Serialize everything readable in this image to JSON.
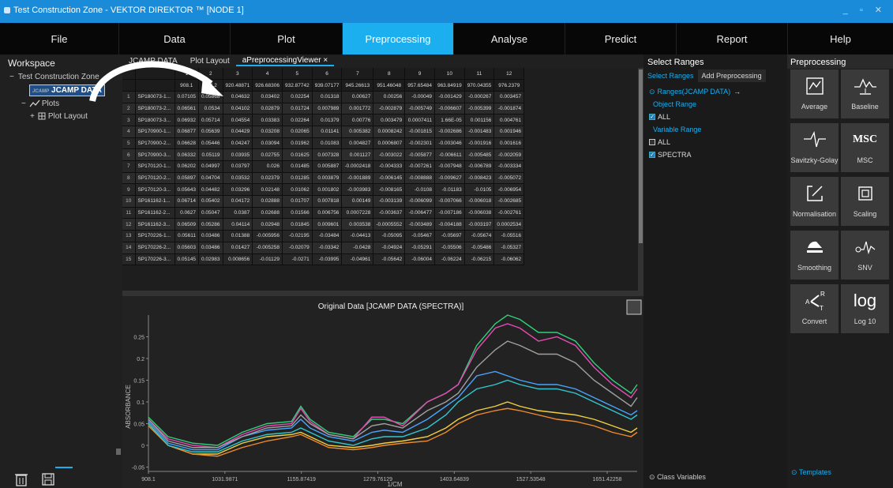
{
  "titlebar": {
    "title": "Test Construction Zone - VEKTOR DIREKTOR ™ [NODE 1]",
    "controls": "_ ▫ ✕"
  },
  "menu": [
    {
      "label": "File"
    },
    {
      "label": "Data"
    },
    {
      "label": "Plot"
    },
    {
      "label": "Preprocessing"
    },
    {
      "label": "Analyse"
    },
    {
      "label": "Predict"
    },
    {
      "label": "Report"
    },
    {
      "label": "Help"
    }
  ],
  "workspace": {
    "header": "Workspace",
    "root": "Test Construction Zone",
    "dataset_tag": "JCAMP",
    "dataset": "JCAMP DATA",
    "plots": "Plots",
    "plot_layout": "Plot Layout"
  },
  "tabs": {
    "t1": "JCAMP DATA",
    "t2": "Plot Layout",
    "t3": "aPreprocessingViewer ×"
  },
  "grid": {
    "col_index": [
      "1",
      "2",
      "3",
      "4",
      "5",
      "6",
      "7",
      "8",
      "9",
      "10",
      "11",
      "12"
    ],
    "col_wave": [
      "908.1",
      "914.2",
      "920.48871",
      "926.68306",
      "932.87742",
      "939.07177",
      "945.26613",
      "951.46048",
      "957.65484",
      "963.84919",
      "970.04355",
      "976.2379"
    ],
    "rows": [
      [
        "1",
        "SP180073-1...",
        "0.07105",
        "0.05868",
        "0.04632",
        "0.03402",
        "0.02254",
        "0.01318",
        "0.00627",
        "0.00256",
        "-0.00049",
        "-0.001429",
        "-0.000267",
        "0.003457"
      ],
      [
        "2",
        "SP180073-2...",
        "0.06561",
        "0.0534",
        "0.04102",
        "0.02879",
        "0.01724",
        "0.007989",
        "0.001772",
        "-0.002879",
        "-0.005749",
        "-0.006607",
        "-0.005399",
        "-0.001874"
      ],
      [
        "3",
        "SP180073-3...",
        "0.06932",
        "0.05714",
        "0.04554",
        "0.03383",
        "0.02264",
        "0.01379",
        "0.00776",
        "0.003479",
        "0.0007411",
        "1.66E-05",
        "0.001156",
        "0.004761"
      ],
      [
        "4",
        "SP170900-1...",
        "0.06877",
        "0.05639",
        "0.04429",
        "0.03208",
        "0.02065",
        "0.01141",
        "0.005382",
        "0.0008242",
        "-0.001815",
        "-0.002686",
        "-0.001483",
        "0.001946"
      ],
      [
        "5",
        "SP170900-2...",
        "0.06628",
        "0.05446",
        "0.04247",
        "0.03094",
        "0.01962",
        "0.01083",
        "0.004827",
        "0.0006807",
        "-0.002301",
        "-0.003046",
        "-0.001916",
        "0.001616"
      ],
      [
        "6",
        "SP170900-3...",
        "0.06332",
        "0.05119",
        "0.03935",
        "0.02755",
        "0.01625",
        "0.007328",
        "0.001127",
        "-0.003022",
        "-0.005877",
        "-0.006611",
        "-0.005485",
        "-0.002059"
      ],
      [
        "7",
        "SP170120-1...",
        "0.06202",
        "0.04997",
        "0.03797",
        "0.026",
        "0.01485",
        "0.005887",
        "-0.0002418",
        "-0.004333",
        "-0.007261",
        "-0.007948",
        "-0.006789",
        "-0.003334"
      ],
      [
        "8",
        "SP170120-2...",
        "0.05897",
        "0.04704",
        "0.03532",
        "0.02379",
        "0.01285",
        "0.003879",
        "-0.001889",
        "-0.006145",
        "-0.008888",
        "-0.009627",
        "-0.008423",
        "-0.005072"
      ],
      [
        "9",
        "SP170120-3...",
        "0.05643",
        "0.04482",
        "0.03296",
        "0.02148",
        "0.01062",
        "0.001802",
        "-0.003983",
        "-0.008165",
        "-0.0108",
        "-0.01183",
        "-0.0105",
        "-0.006954"
      ],
      [
        "10",
        "SP161162-1...",
        "0.06714",
        "0.05402",
        "0.04172",
        "0.02888",
        "0.01707",
        "0.007818",
        "0.00149",
        "-0.003139",
        "-0.006099",
        "-0.007066",
        "-0.006018",
        "-0.002685"
      ],
      [
        "11",
        "SP161162-2...",
        "0.0627",
        "0.05047",
        "0.0387",
        "0.02688",
        "0.01566",
        "0.006756",
        "0.0007228",
        "-0.003637",
        "-0.006477",
        "-0.007186",
        "-0.006038",
        "-0.002761"
      ],
      [
        "12",
        "SP161162-3...",
        "0.06509",
        "0.05286",
        "0.04114",
        "0.02948",
        "0.01845",
        "0.009601",
        "0.003538",
        "-0.0005552",
        "-0.003489",
        "-0.004188",
        "-0.003197",
        "0.0002534"
      ],
      [
        "13",
        "SP170226-1...",
        "0.05611",
        "0.03486",
        "0.01388",
        "-0.005956",
        "-0.02195",
        "-0.03484",
        "-0.04413",
        "-0.05095",
        "-0.05467",
        "-0.05697",
        "-0.05674",
        "-0.05516"
      ],
      [
        "14",
        "SP170226-2...",
        "0.05603",
        "0.03486",
        "0.01427",
        "-0.005258",
        "-0.02079",
        "-0.03342",
        "-0.0428",
        "-0.04924",
        "-0.05291",
        "-0.05506",
        "-0.05486",
        "-0.05327"
      ],
      [
        "15",
        "SP170226-3...",
        "0.05145",
        "0.02983",
        "0.008656",
        "-0.01129",
        "-0.0271",
        "-0.03995",
        "-0.04961",
        "-0.05642",
        "-0.06004",
        "-0.06224",
        "-0.06215",
        "-0.06062"
      ]
    ]
  },
  "chart_data": {
    "type": "line",
    "title": "Original Data [JCAMP DATA (SPECTRA)]",
    "xlabel": "1/CM",
    "ylabel": "ABSORBANCE",
    "xlim": [
      908.1,
      1700
    ],
    "ylim": [
      -0.06,
      0.3
    ],
    "x_ticks": [
      "908.1",
      "1031.9871",
      "1155.87419",
      "1279.76129",
      "1403.64839",
      "1527.53548",
      "1651.42258"
    ],
    "y_ticks": [
      "-0.05",
      "0",
      "0.05",
      "0.1",
      "0.15",
      "0.2",
      "0.25"
    ],
    "x": [
      908,
      940,
      980,
      1020,
      1060,
      1100,
      1140,
      1155,
      1170,
      1200,
      1240,
      1270,
      1290,
      1320,
      1360,
      1390,
      1410,
      1440,
      1470,
      1490,
      1510,
      1540,
      1570,
      1600,
      1630,
      1660,
      1690,
      1700
    ],
    "series": [
      {
        "color": "#2fd07a",
        "values": [
          0.065,
          0.02,
          0.005,
          0,
          0.03,
          0.05,
          0.055,
          0.09,
          0.06,
          0.03,
          0.02,
          0.06,
          0.06,
          0.05,
          0.1,
          0.12,
          0.14,
          0.23,
          0.28,
          0.3,
          0.29,
          0.26,
          0.26,
          0.24,
          0.19,
          0.15,
          0.12,
          0.14
        ]
      },
      {
        "color": "#e64bb5",
        "values": [
          0.06,
          0.015,
          0,
          -0.005,
          0.025,
          0.045,
          0.05,
          0.085,
          0.055,
          0.025,
          0.015,
          0.065,
          0.065,
          0.045,
          0.1,
          0.12,
          0.14,
          0.22,
          0.27,
          0.28,
          0.27,
          0.24,
          0.25,
          0.23,
          0.18,
          0.14,
          0.11,
          0.13
        ]
      },
      {
        "color": "#4aa3ff",
        "values": [
          0.055,
          0.005,
          -0.01,
          -0.01,
          0.02,
          0.035,
          0.04,
          0.06,
          0.04,
          0.02,
          0.01,
          0.03,
          0.035,
          0.03,
          0.06,
          0.09,
          0.11,
          0.16,
          0.17,
          0.16,
          0.15,
          0.14,
          0.14,
          0.13,
          0.11,
          0.09,
          0.07,
          0.08
        ]
      },
      {
        "color": "#f0d040",
        "values": [
          0.05,
          0,
          -0.02,
          -0.02,
          0.005,
          0.02,
          0.025,
          0.03,
          0.02,
          0.0,
          -0.005,
          0.0,
          0.005,
          0.01,
          0.02,
          0.04,
          0.06,
          0.08,
          0.09,
          0.1,
          0.09,
          0.08,
          0.075,
          0.07,
          0.06,
          0.045,
          0.03,
          0.04
        ]
      },
      {
        "color": "#f08a2a",
        "values": [
          0.045,
          0.0,
          -0.02,
          -0.025,
          -0.005,
          0.01,
          0.02,
          0.025,
          0.015,
          -0.005,
          -0.01,
          -0.005,
          0.0,
          0.005,
          0.01,
          0.03,
          0.05,
          0.07,
          0.08,
          0.085,
          0.08,
          0.07,
          0.06,
          0.055,
          0.045,
          0.03,
          0.02,
          0.03
        ]
      },
      {
        "color": "#a0a0a0",
        "values": [
          0.06,
          0.01,
          -0.005,
          -0.005,
          0.02,
          0.04,
          0.045,
          0.07,
          0.05,
          0.025,
          0.015,
          0.045,
          0.05,
          0.04,
          0.08,
          0.1,
          0.12,
          0.18,
          0.22,
          0.24,
          0.23,
          0.21,
          0.21,
          0.19,
          0.15,
          0.12,
          0.09,
          0.11
        ]
      },
      {
        "color": "#30c8d0",
        "values": [
          0.05,
          0.0,
          -0.015,
          -0.015,
          0.01,
          0.025,
          0.03,
          0.04,
          0.03,
          0.01,
          0.0,
          0.015,
          0.02,
          0.02,
          0.04,
          0.07,
          0.1,
          0.13,
          0.14,
          0.15,
          0.14,
          0.13,
          0.13,
          0.12,
          0.1,
          0.08,
          0.06,
          0.07
        ]
      }
    ]
  },
  "ranges": {
    "header": "Select Ranges",
    "tab1": "Select Ranges",
    "tab2": "Add Preprocessing",
    "ranges_label": "Ranges(JCAMP DATA)",
    "object_range": "Object Range",
    "obj_all": "ALL",
    "variable_range": "Variable Range",
    "var_all": "ALL",
    "spectra": "SPECTRA",
    "class_vars": "Class Variables"
  },
  "preprocessing": {
    "header": "Preprocessing",
    "tiles": [
      "Average",
      "Baseline",
      "Savitzky-Golay",
      "MSC",
      "Normalisation",
      "Scaling",
      "Smoothing",
      "SNV",
      "Convert",
      "Log 10"
    ],
    "msc_glyph": "MSC",
    "log_glyph": "log",
    "templates": "Templates"
  },
  "colors": {
    "accent": "#1caff0",
    "titlebar": "#1a8bd8"
  }
}
